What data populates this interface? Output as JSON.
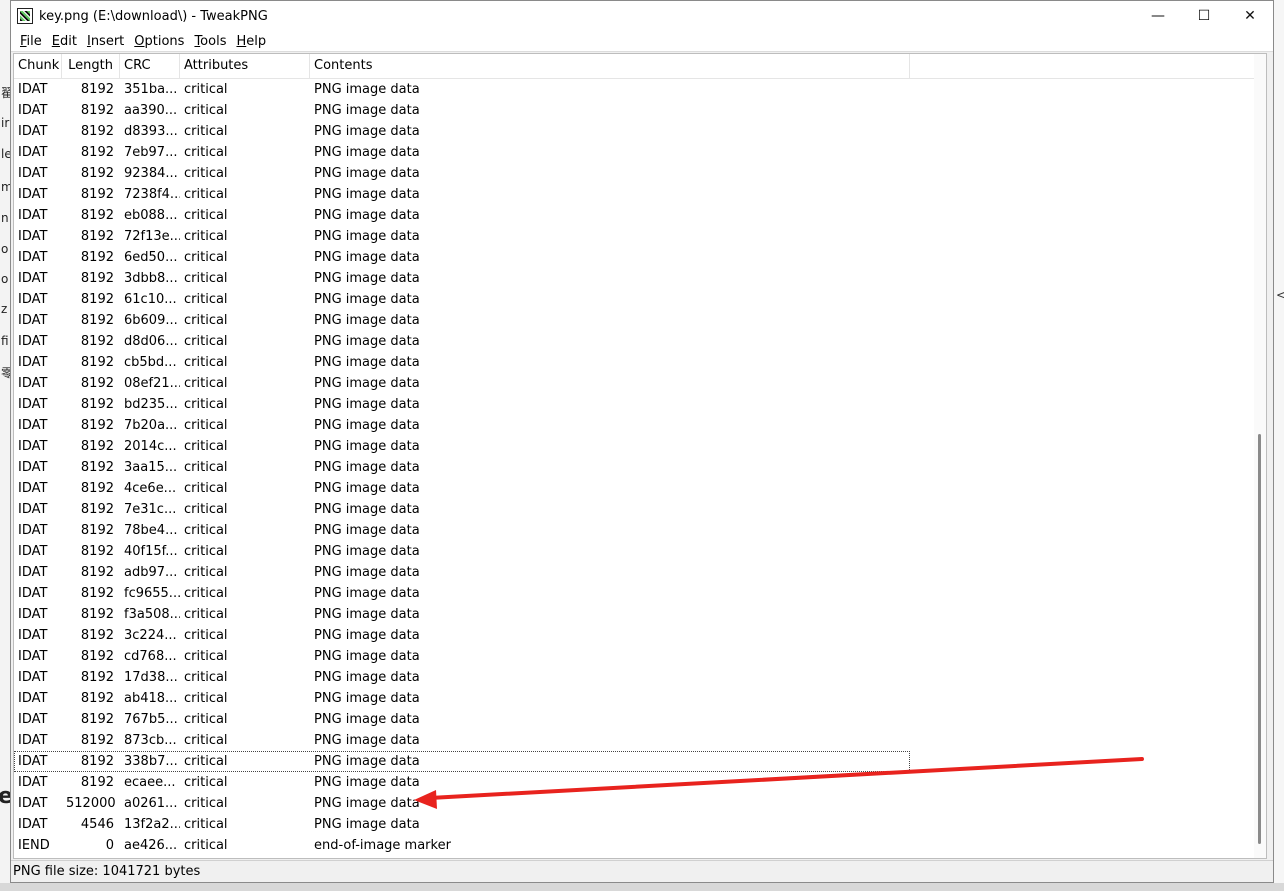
{
  "window": {
    "title": "key.png (E:\\download\\) - TweakPNG",
    "controls": {
      "minimize": "—",
      "maximize": "☐",
      "close": "✕"
    }
  },
  "menu": [
    {
      "accel": "F",
      "rest": "ile"
    },
    {
      "accel": "E",
      "rest": "dit"
    },
    {
      "accel": "I",
      "rest": "nsert"
    },
    {
      "accel": "O",
      "rest": "ptions"
    },
    {
      "accel": "T",
      "rest": "ools"
    },
    {
      "accel": "H",
      "rest": "elp"
    }
  ],
  "columns": [
    "Chunk",
    "Length",
    "CRC",
    "Attributes",
    "Contents"
  ],
  "rows": [
    [
      "IDAT",
      "8192",
      "351ba...",
      "critical",
      "PNG image data"
    ],
    [
      "IDAT",
      "8192",
      "aa390...",
      "critical",
      "PNG image data"
    ],
    [
      "IDAT",
      "8192",
      "d8393...",
      "critical",
      "PNG image data"
    ],
    [
      "IDAT",
      "8192",
      "7eb97...",
      "critical",
      "PNG image data"
    ],
    [
      "IDAT",
      "8192",
      "92384...",
      "critical",
      "PNG image data"
    ],
    [
      "IDAT",
      "8192",
      "7238f4...",
      "critical",
      "PNG image data"
    ],
    [
      "IDAT",
      "8192",
      "eb088...",
      "critical",
      "PNG image data"
    ],
    [
      "IDAT",
      "8192",
      "72f13e...",
      "critical",
      "PNG image data"
    ],
    [
      "IDAT",
      "8192",
      "6ed50...",
      "critical",
      "PNG image data"
    ],
    [
      "IDAT",
      "8192",
      "3dbb8...",
      "critical",
      "PNG image data"
    ],
    [
      "IDAT",
      "8192",
      "61c10...",
      "critical",
      "PNG image data"
    ],
    [
      "IDAT",
      "8192",
      "6b609...",
      "critical",
      "PNG image data"
    ],
    [
      "IDAT",
      "8192",
      "d8d06...",
      "critical",
      "PNG image data"
    ],
    [
      "IDAT",
      "8192",
      "cb5bd...",
      "critical",
      "PNG image data"
    ],
    [
      "IDAT",
      "8192",
      "08ef21...",
      "critical",
      "PNG image data"
    ],
    [
      "IDAT",
      "8192",
      "bd235...",
      "critical",
      "PNG image data"
    ],
    [
      "IDAT",
      "8192",
      "7b20a...",
      "critical",
      "PNG image data"
    ],
    [
      "IDAT",
      "8192",
      "2014c...",
      "critical",
      "PNG image data"
    ],
    [
      "IDAT",
      "8192",
      "3aa15...",
      "critical",
      "PNG image data"
    ],
    [
      "IDAT",
      "8192",
      "4ce6e...",
      "critical",
      "PNG image data"
    ],
    [
      "IDAT",
      "8192",
      "7e31c...",
      "critical",
      "PNG image data"
    ],
    [
      "IDAT",
      "8192",
      "78be4...",
      "critical",
      "PNG image data"
    ],
    [
      "IDAT",
      "8192",
      "40f15f...",
      "critical",
      "PNG image data"
    ],
    [
      "IDAT",
      "8192",
      "adb97...",
      "critical",
      "PNG image data"
    ],
    [
      "IDAT",
      "8192",
      "fc9655...",
      "critical",
      "PNG image data"
    ],
    [
      "IDAT",
      "8192",
      "f3a508...",
      "critical",
      "PNG image data"
    ],
    [
      "IDAT",
      "8192",
      "3c224...",
      "critical",
      "PNG image data"
    ],
    [
      "IDAT",
      "8192",
      "cd768...",
      "critical",
      "PNG image data"
    ],
    [
      "IDAT",
      "8192",
      "17d38...",
      "critical",
      "PNG image data"
    ],
    [
      "IDAT",
      "8192",
      "ab418...",
      "critical",
      "PNG image data"
    ],
    [
      "IDAT",
      "8192",
      "767b5...",
      "critical",
      "PNG image data"
    ],
    [
      "IDAT",
      "8192",
      "873cb...",
      "critical",
      "PNG image data"
    ],
    [
      "IDAT",
      "8192",
      "338b7...",
      "critical",
      "PNG image data"
    ],
    [
      "IDAT",
      "8192",
      "ecaee...",
      "critical",
      "PNG image data"
    ],
    [
      "IDAT",
      "512000",
      "a0261...",
      "critical",
      "PNG image data"
    ],
    [
      "IDAT",
      "4546",
      "13f2a2...",
      "critical",
      "PNG image data"
    ],
    [
      "IEND",
      "0",
      "ae426...",
      "critical",
      "end-of-image marker"
    ]
  ],
  "focused_row_index": 32,
  "status": "PNG file size: 1041721 bytes",
  "annotation": {
    "color": "#e8231e"
  },
  "background_fragments": {
    "left": [
      "翟",
      "ir",
      "le",
      "m",
      "n",
      "o",
      "o",
      "z",
      "fi",
      "零",
      "e"
    ],
    "right": [
      "<"
    ]
  },
  "colors": {
    "window_bg": "#f0f0f0",
    "list_bg": "#ffffff",
    "arrow": "#e8231e"
  }
}
